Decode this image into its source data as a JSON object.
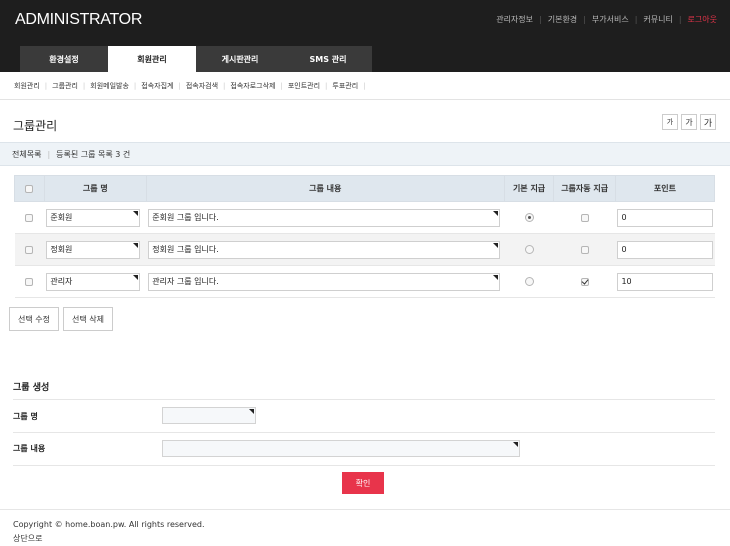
{
  "header": {
    "logo": "ADMINISTRATOR",
    "top_links": [
      "관리자정보",
      "기본환경",
      "부가서비스",
      "커뮤니티"
    ],
    "logout": "로그아웃",
    "main_tabs": [
      "환경설정",
      "회원관리",
      "게시판관리",
      "SMS 관리"
    ],
    "active_tab": "회원관리"
  },
  "subnav": [
    "회원관리",
    "그룹관리",
    "회원메일발송",
    "접속자집계",
    "접속자검색",
    "접속자로그삭제",
    "포인트관리",
    "투표관리"
  ],
  "page": {
    "title": "그룹관리",
    "font_buttons": [
      "가",
      "가",
      "가"
    ]
  },
  "summary": {
    "all_list": "전체목록",
    "count_text": "등록된 그룹 목록 3 건"
  },
  "table": {
    "headers": [
      "그룹 명",
      "그룹 내용",
      "기본 지급",
      "그룹자동 지급",
      "포인트"
    ],
    "rows": [
      {
        "name": "준회원",
        "desc": "준회원 그룹 입니다.",
        "default": true,
        "auto": false,
        "point": "0"
      },
      {
        "name": "정회원",
        "desc": "정회원 그룹 입니다.",
        "default": false,
        "auto": false,
        "point": "0"
      },
      {
        "name": "관리자",
        "desc": "관리자 그룹 입니다.",
        "default": false,
        "auto": true,
        "point": "10"
      }
    ]
  },
  "actions": {
    "edit": "선택 수정",
    "delete": "선택 삭제"
  },
  "create_form": {
    "title": "그룹 생성",
    "name_label": "그룹 명",
    "desc_label": "그룹 내용",
    "confirm": "확인"
  },
  "footer": {
    "copyright": "Copyright © home.boan.pw. All rights reserved.",
    "to_top": "상단으로"
  },
  "colors": {
    "header_bg": "#1e1e1e",
    "accent": "#e8344b",
    "table_header_bg": "#dfe7ee",
    "summary_bg": "#eef3f7"
  }
}
